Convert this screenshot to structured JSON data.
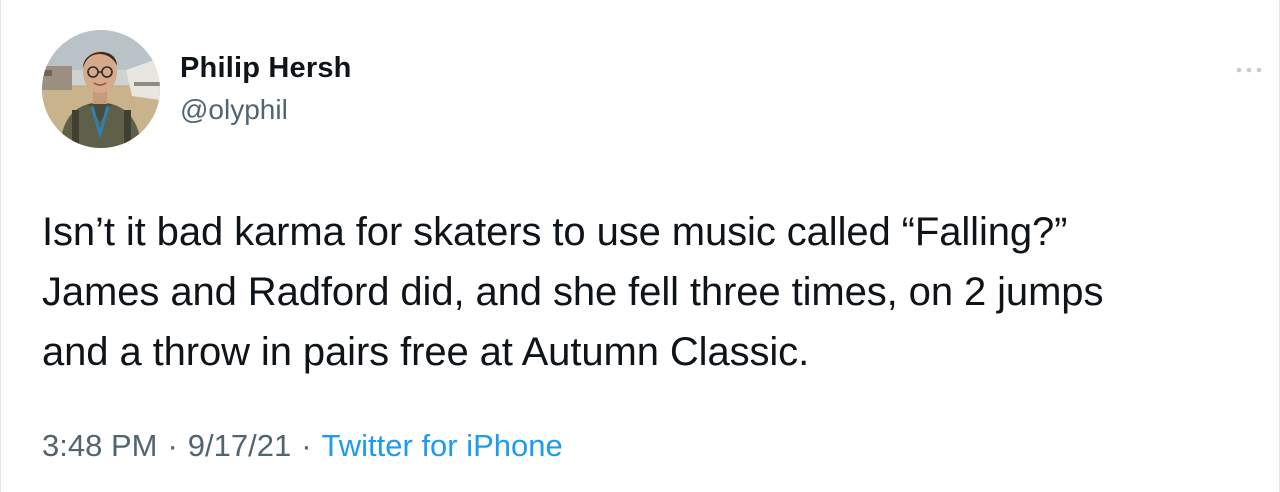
{
  "author": {
    "name": "Philip Hersh",
    "handle": "@olyphil",
    "avatar_icon": "profile-photo"
  },
  "menu": {
    "icon": "more-horizontal-icon"
  },
  "tweet": {
    "text": "Isn’t it bad karma for skaters to use music called “Falling?”\nJames and Radford did, and she fell three times, on 2 jumps\nand a throw in pairs free at Autumn Classic."
  },
  "meta": {
    "time": "3:48 PM",
    "separator": "·",
    "date": "9/17/21",
    "source": "Twitter for iPhone"
  },
  "colors": {
    "text": "#0f1419",
    "secondary": "#536471",
    "link": "#1d9bf0"
  }
}
